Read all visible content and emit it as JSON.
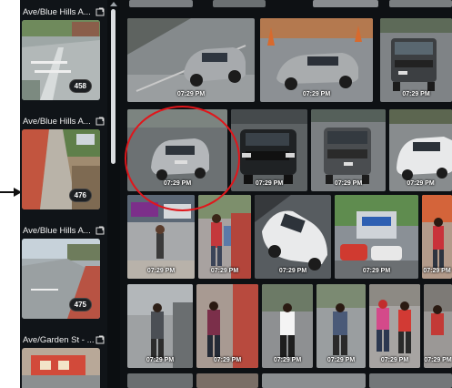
{
  "cameras": [
    {
      "title": "Ave/Blue Hills A...",
      "count": "458"
    },
    {
      "title": "Ave/Blue Hills A...",
      "count": "476"
    },
    {
      "title": "Ave/Blue Hills A...",
      "count": "475"
    },
    {
      "title": "Ave/Garden St - ...",
      "count": ""
    }
  ],
  "timestamp": "07:29 PM",
  "colors": {
    "highlight": "#e0161b",
    "sidebar_bg": "#101418"
  }
}
